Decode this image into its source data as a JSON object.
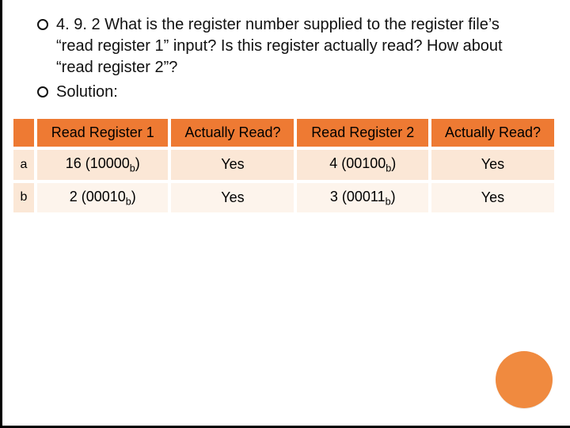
{
  "bullets": [
    "4. 9. 2 What is the register number supplied to the register file’s “read register 1” input? Is this register actually read? How about “read register 2”?",
    "Solution:"
  ],
  "table": {
    "headers": [
      "Read Register 1",
      "Actually Read?",
      "Read Register 2",
      "Actually Read?"
    ],
    "rows": [
      {
        "label": "a",
        "cells": [
          {
            "text": "16 (10000",
            "sub": "b",
            "suffix": ")"
          },
          {
            "text": "Yes"
          },
          {
            "text": "4 (00100",
            "sub": "b",
            "suffix": ")"
          },
          {
            "text": "Yes"
          }
        ]
      },
      {
        "label": "b",
        "cells": [
          {
            "text": "2 (00010",
            "sub": "b",
            "suffix": ")"
          },
          {
            "text": "Yes"
          },
          {
            "text": "3 (00011",
            "sub": "b",
            "suffix": ")"
          },
          {
            "text": "Yes"
          }
        ]
      }
    ]
  },
  "deco": {
    "corner_circle_color": "#f08a3f"
  }
}
